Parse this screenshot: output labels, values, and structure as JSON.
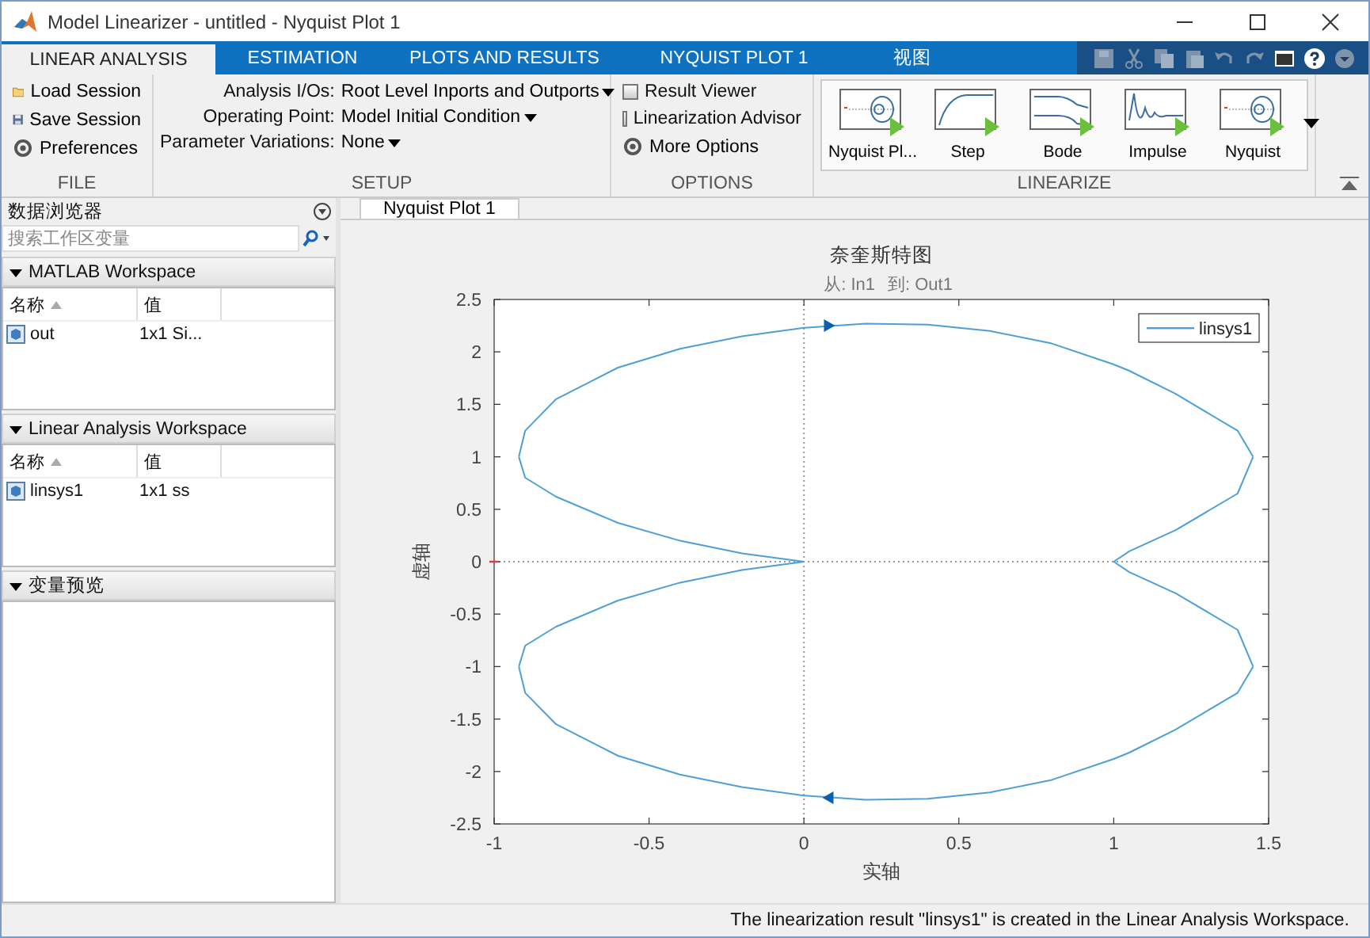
{
  "window": {
    "title": "Model Linearizer - untitled - Nyquist Plot 1"
  },
  "tabs": [
    {
      "label": "LINEAR ANALYSIS",
      "selected": true
    },
    {
      "label": "ESTIMATION",
      "selected": false
    },
    {
      "label": "PLOTS AND RESULTS",
      "selected": false
    },
    {
      "label": "NYQUIST PLOT 1",
      "selected": false
    },
    {
      "label": "视图",
      "selected": false
    }
  ],
  "toolstrip": {
    "file": {
      "label": "FILE",
      "buttons": [
        {
          "label": "Load Session",
          "kind": "folder"
        },
        {
          "label": "Save Session",
          "kind": "save"
        },
        {
          "label": "Preferences",
          "kind": "gear"
        }
      ]
    },
    "setup": {
      "label": "SETUP",
      "fields": [
        {
          "label": "Analysis I/Os:",
          "value": "Root Level Inports and Outports"
        },
        {
          "label": "Operating Point:",
          "value": "Model Initial Condition"
        },
        {
          "label": "Parameter Variations:",
          "value": "None"
        }
      ]
    },
    "options": {
      "label": "OPTIONS",
      "checkboxes": [
        {
          "label": "Result Viewer",
          "checked": false
        },
        {
          "label": "Linearization Advisor",
          "checked": false
        }
      ],
      "more": "More Options"
    },
    "linearize": {
      "label": "LINEARIZE",
      "plots": [
        {
          "label": "Nyquist Pl...",
          "kind": "nyquist"
        },
        {
          "label": "Step",
          "kind": "step"
        },
        {
          "label": "Bode",
          "kind": "bode"
        },
        {
          "label": "Impulse",
          "kind": "impulse"
        },
        {
          "label": "Nyquist",
          "kind": "nyquist"
        }
      ]
    }
  },
  "data_browser": {
    "title": "数据浏览器",
    "search": {
      "placeholder": "搜索工作区变量"
    },
    "sections": [
      {
        "title": "MATLAB Workspace",
        "expanded": true,
        "columns": [
          "名称",
          "值"
        ],
        "rows": [
          {
            "name": "out",
            "value": "1x1 Si..."
          }
        ]
      },
      {
        "title": "Linear Analysis Workspace",
        "expanded": true,
        "columns": [
          "名称",
          "值"
        ],
        "rows": [
          {
            "name": "linsys1",
            "value": "1x1 ss"
          }
        ]
      },
      {
        "title": "变量预览",
        "expanded": true
      }
    ]
  },
  "documents": [
    {
      "label": "Nyquist Plot 1",
      "selected": true
    }
  ],
  "plot": {
    "from": "从: In1",
    "to": "到: Out1",
    "chart_data": {
      "type": "line",
      "title": "奈奎斯特图",
      "xlabel": "实轴",
      "ylabel": "虚轴",
      "x": [
        -0.92,
        -0.9,
        -0.8,
        -0.6,
        -0.4,
        -0.2,
        0,
        0.2,
        0.4,
        0.6,
        0.8,
        1.0,
        1.05,
        1.2,
        1.4,
        1.45
      ],
      "series": [
        {
          "name": "linsys1",
          "color": "#4d9fd9",
          "values": [
            1.0,
            1.25,
            1.55,
            1.85,
            2.03,
            2.15,
            2.23,
            2.27,
            2.26,
            2.2,
            2.08,
            1.88,
            1.82,
            1.6,
            1.25,
            1.0
          ]
        },
        {
          "color": "#4d9fd9",
          "values": [
            1.0,
            0.8,
            0.62,
            0.37,
            0.2,
            0.08,
            0,
            null,
            null,
            null,
            null,
            0,
            0.1,
            0.3,
            0.65,
            1.0
          ]
        },
        {
          "color": "#4d9fd9",
          "values": [
            -1.0,
            -0.8,
            -0.62,
            -0.37,
            -0.2,
            -0.08,
            0,
            null,
            null,
            null,
            null,
            0,
            -0.1,
            -0.3,
            -0.65,
            -1.0
          ]
        },
        {
          "color": "#4d9fd9",
          "values": [
            -1.0,
            -1.25,
            -1.55,
            -1.85,
            -2.03,
            -2.15,
            -2.23,
            -2.27,
            -2.26,
            -2.2,
            -2.08,
            -1.88,
            -1.82,
            -1.6,
            -1.25,
            -1.0
          ]
        }
      ],
      "xlim": [
        -1,
        1.5
      ],
      "ylim": [
        -2.5,
        2.5
      ],
      "xticks": [
        -1,
        -0.5,
        0,
        0.5,
        1,
        1.5
      ],
      "yticks": [
        -2.5,
        -2,
        -1.5,
        -1,
        -0.5,
        0,
        0.5,
        1,
        1.5,
        2,
        2.5
      ]
    }
  },
  "status_bar": "The linearization result \"linsys1\" is created in the Linear Analysis Workspace."
}
